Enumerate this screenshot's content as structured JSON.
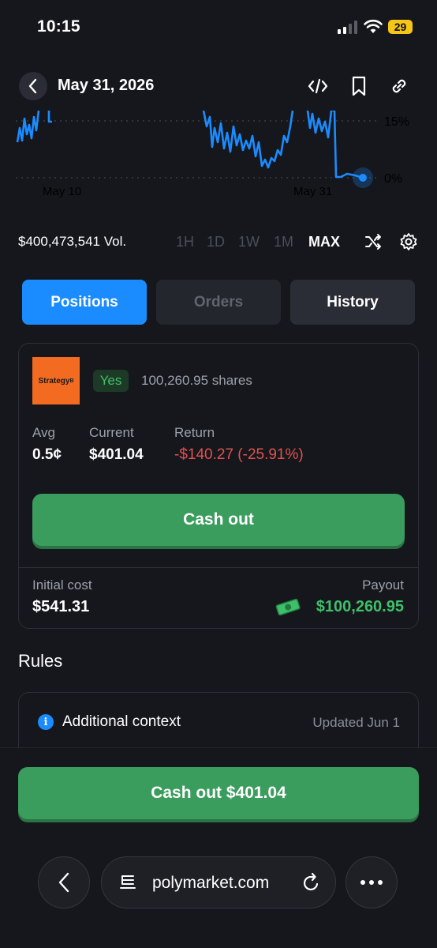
{
  "status_bar": {
    "time": "10:15",
    "battery": "29"
  },
  "header": {
    "title": "May 31, 2026",
    "icons": [
      "embed-icon",
      "bookmark-icon",
      "link-icon"
    ]
  },
  "chart": {
    "y_ticks": [
      "15%",
      "0%"
    ],
    "x_ticks": [
      "May 10",
      "May 31"
    ],
    "line_color": "#1a8cff"
  },
  "volume": "$400,473,541 Vol.",
  "ranges": [
    "1H",
    "1D",
    "1W",
    "1M",
    "MAX"
  ],
  "active_range": "MAX",
  "tabs": {
    "positions": "Positions",
    "orders": "Orders",
    "history": "History"
  },
  "position": {
    "logo_text": "Strategy",
    "logo_sup": "B",
    "outcome": "Yes",
    "shares": "100,260.95 shares",
    "avg_label": "Avg",
    "avg_value": "0.5¢",
    "current_label": "Current",
    "current_value": "$401.04",
    "return_label": "Return",
    "return_value": "-$140.27 (-25.91%)",
    "cash_out_label": "Cash out",
    "initial_cost_label": "Initial cost",
    "initial_cost_value": "$541.31",
    "payout_label": "Payout",
    "payout_value": "$100,260.95"
  },
  "rules": {
    "title": "Rules",
    "context_label": "Additional context",
    "updated": "Updated Jun 1"
  },
  "bottom_cash_out": "Cash out $401.04",
  "browser": {
    "url": "polymarket.com"
  },
  "colors": {
    "accent": "#1a8cff",
    "green": "#3a9c5d",
    "red": "#e0524f",
    "background": "#15171c"
  }
}
